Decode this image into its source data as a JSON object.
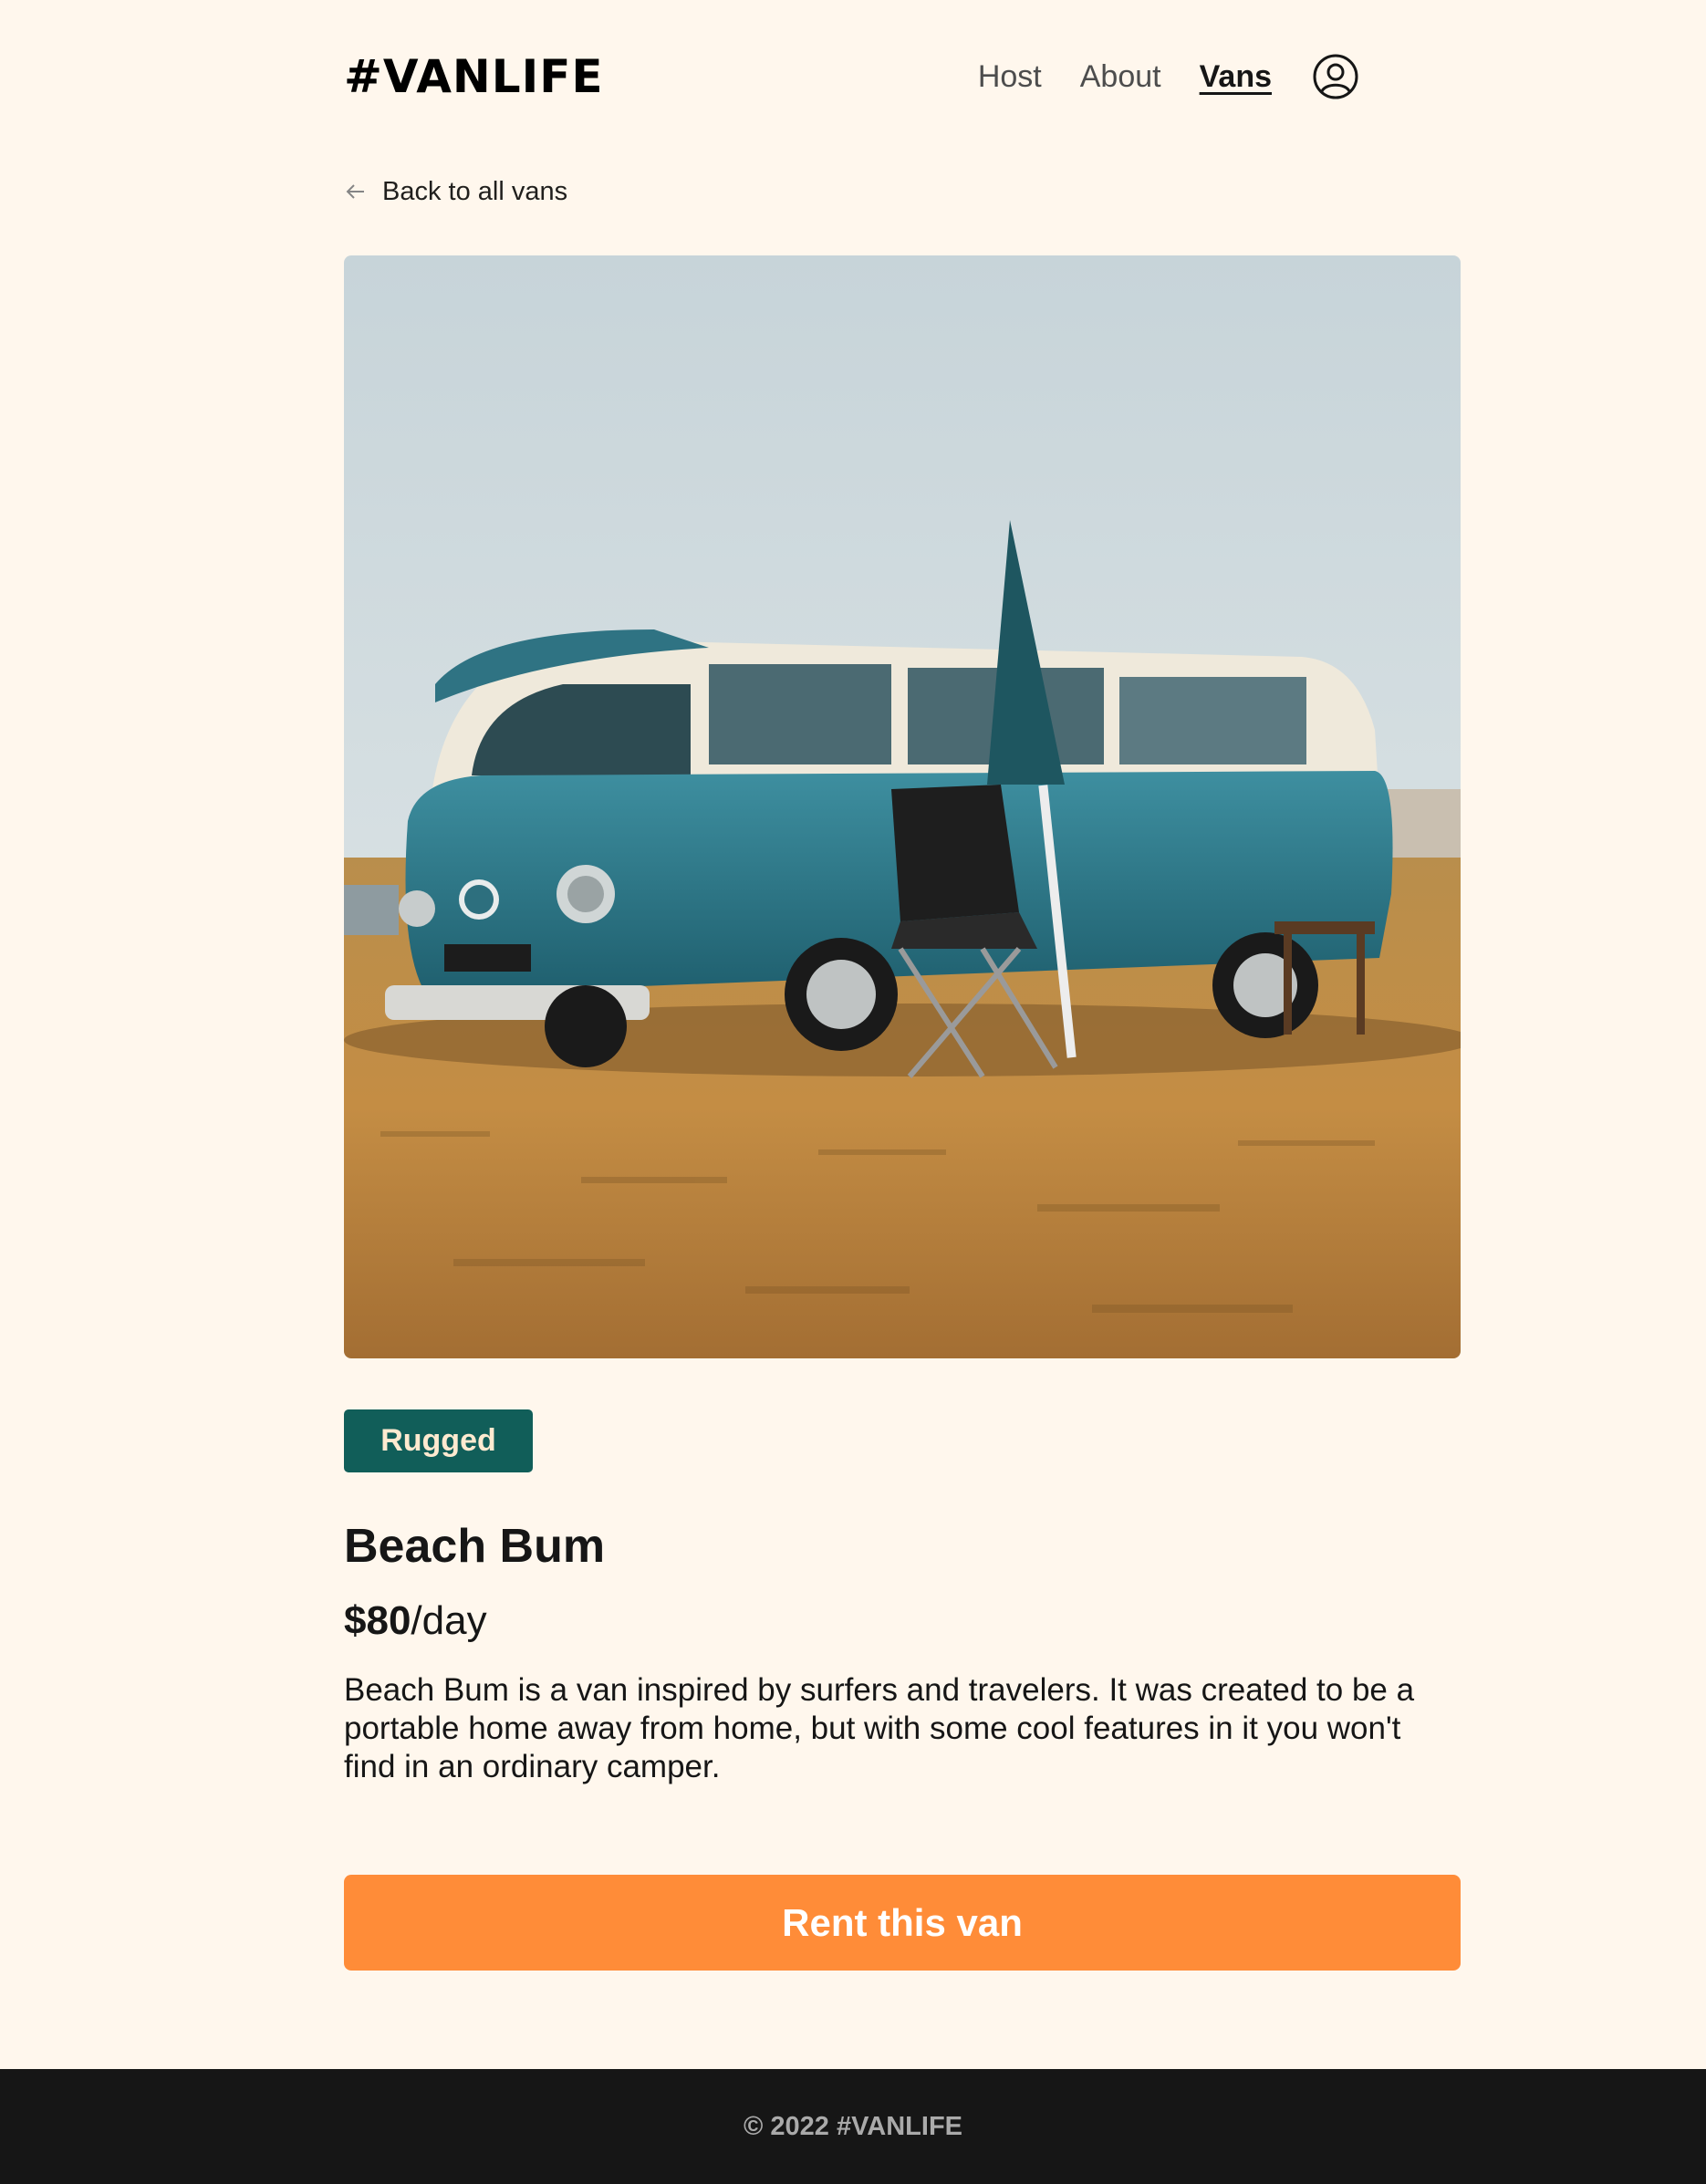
{
  "header": {
    "logo": "#VANLIFE",
    "nav": {
      "host": "Host",
      "about": "About",
      "vans": "Vans",
      "active": "Vans"
    },
    "avatar_icon": "user-circle-icon"
  },
  "back_link": {
    "label": "Back to all vans",
    "icon": "arrow-left-icon"
  },
  "van": {
    "image_alt": "Teal VW camper van parked on dry grass with a folding chair and closed umbrella",
    "type_badge": "Rugged",
    "name": "Beach Bum",
    "price_amount": "$80",
    "price_unit": "/day",
    "description": "Beach Bum is a van inspired by surfers and travelers. It was created to be a portable home away from home, but with some cool features in it you won't find in an ordinary camper."
  },
  "cta": {
    "label": "Rent this van"
  },
  "footer": {
    "copyright": "© 2022 #VANLIFE"
  },
  "colors": {
    "background": "#FFF7ED",
    "badge_bg": "#115E59",
    "badge_text": "#FFEAD0",
    "cta_bg": "#FF8C38",
    "footer_bg": "#161616",
    "text": "#161616"
  }
}
